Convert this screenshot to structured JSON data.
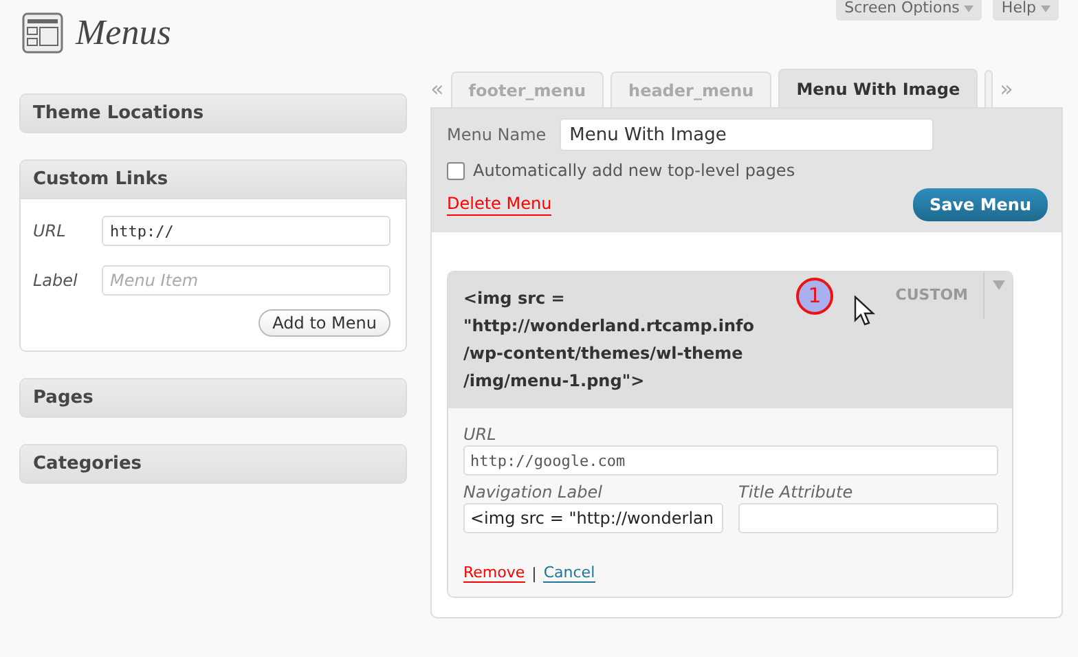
{
  "header": {
    "title": "Menus",
    "screen_options": "Screen Options",
    "help": "Help"
  },
  "sidebar": [
    {
      "title": "Theme Locations",
      "kind": "closed"
    },
    {
      "title": "Custom Links",
      "kind": "form",
      "fields": [
        {
          "label": "URL",
          "value": "http://"
        },
        {
          "label": "Label",
          "placeholder": "Menu Item"
        }
      ],
      "button": "Add to Menu"
    },
    {
      "title": "Pages",
      "kind": "closed"
    },
    {
      "title": "Categories",
      "kind": "closed"
    }
  ],
  "tabs": {
    "prev": "«",
    "next": "»",
    "items": [
      {
        "label": "footer_menu",
        "selected": false
      },
      {
        "label": "header_menu",
        "selected": false
      },
      {
        "label": "Menu With Image",
        "selected": true
      }
    ]
  },
  "menu": {
    "name_label": "Menu Name",
    "name_value": "Menu With Image",
    "auto_add": {
      "label": "Automatically add new top-level pages",
      "checked": false
    },
    "delete": "Delete Menu",
    "save": "Save Menu",
    "item": {
      "title_lines": [
        "<img src =",
        "\"http://wonderland.rtcamp.info",
        "/wp-content/themes/wl-theme",
        "/img/menu-1.png\">"
      ],
      "type": "CUSTOM",
      "badge": "1",
      "expanded": true,
      "url_label": "URL",
      "url_value": "http://google.com",
      "nav_label": "Navigation Label",
      "nav_value": "<img src = \"http://wonderlan",
      "title_attr_label": "Title Attribute",
      "remove": "Remove",
      "sep": "|",
      "cancel": "Cancel"
    }
  }
}
